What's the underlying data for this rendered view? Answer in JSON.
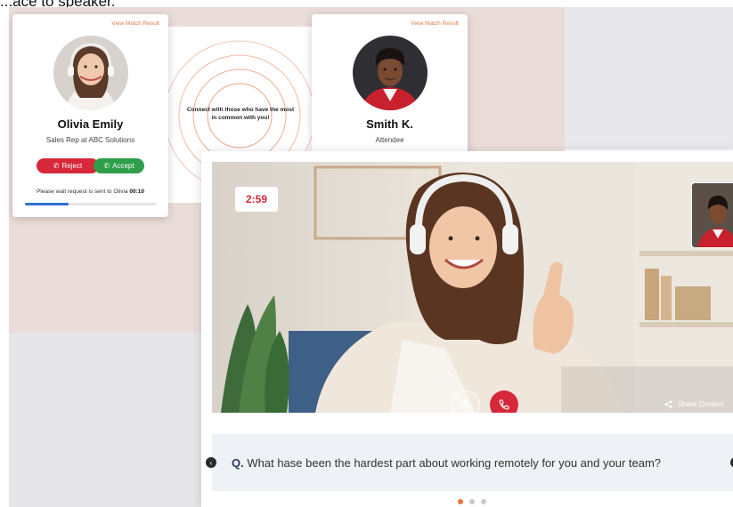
{
  "caption": "...ace to speaker.",
  "match_left": {
    "link": "View Match Result",
    "name": "Olivia Emily",
    "role": "Sales Rep at ABC Solutions",
    "reject_label": "Reject",
    "accept_label": "Accept",
    "wait_text": "Please wait request is sent to Olivia",
    "countdown": "00:10",
    "progress": 0.33
  },
  "center": {
    "text": "Connect with those who have the most in common with you!"
  },
  "match_right": {
    "link": "View Match Result",
    "name": "Smith K.",
    "role": "Attendee"
  },
  "call": {
    "timer": "2:59",
    "share_label": "Share Contact",
    "icons": [
      "microphone-icon",
      "end-call-icon",
      "share-icon"
    ]
  },
  "question": {
    "prefix": "Q.",
    "text": "What hase been the hardest part about  working remotely  for you and your team?"
  },
  "carousel": {
    "total": 3,
    "active": 1
  },
  "colors": {
    "accent_orange": "#e8763c",
    "reject_red": "#d62839",
    "accept_green": "#2e9e4a",
    "progress_blue": "#2f6fd6",
    "pink_bg": "#eadcd8"
  }
}
